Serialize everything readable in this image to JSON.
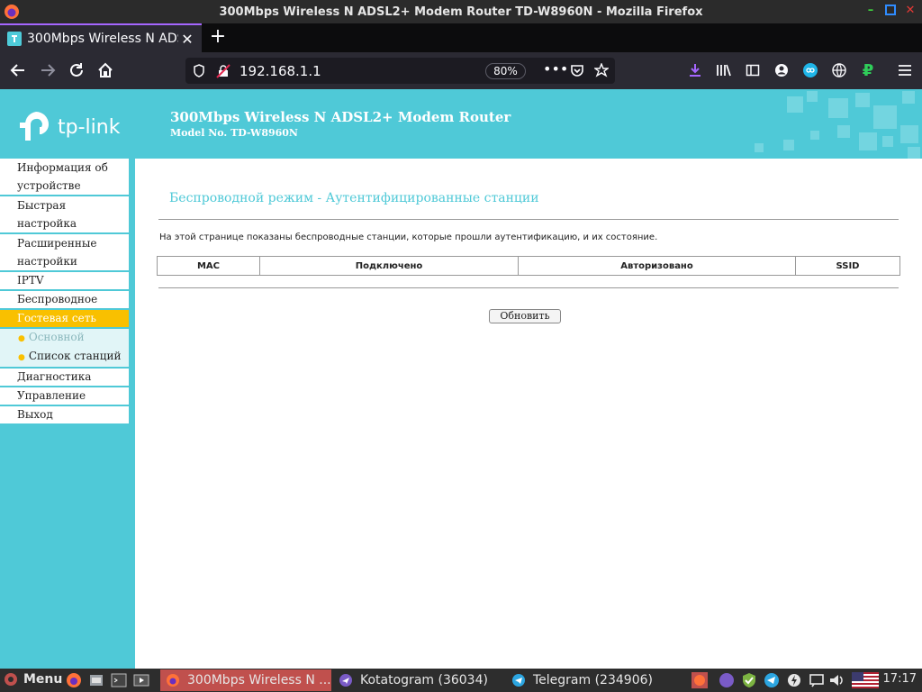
{
  "window": {
    "title": "300Mbps Wireless N ADSL2+ Modem Router TD-W8960N - Mozilla Firefox"
  },
  "browser": {
    "tabs": [
      {
        "label": "300Mbps Wireless N ADS",
        "active": true
      }
    ],
    "url": "192.168.1.1",
    "zoom": "80%"
  },
  "page": {
    "logo_text": "tp-link",
    "header_title": "300Mbps Wireless N ADSL2+ Modem Router",
    "header_model": "Model No. TD-W8960N",
    "menu": {
      "info": "Информация об устройстве",
      "quick": "Быстрая настройка",
      "advanced": "Расширенные настройки",
      "iptv": "IPTV",
      "wireless": "Беспроводное",
      "guest": "Гостевая сеть",
      "sub_basic": "Основной",
      "sub_stations": "Список станций",
      "diag": "Диагностика",
      "manage": "Управление",
      "logout": "Выход"
    },
    "content": {
      "title": "Беспроводной режим - Аутентифицированные станции",
      "description": "На этой странице показаны беспроводные станции, которые прошли аутентификацию, и их состояние.",
      "table_headers": [
        "MAC",
        "Подключено",
        "Авторизовано",
        "SSID"
      ],
      "refresh_label": "Обновить"
    }
  },
  "taskbar": {
    "menu_label": "Menu",
    "tasks": [
      {
        "label": "300Mbps Wireless N ...",
        "active": true
      },
      {
        "label": "Kotatogram (36034)",
        "active": false
      },
      {
        "label": "Telegram (234906)",
        "active": false
      }
    ],
    "clock": "17:17"
  },
  "colors": {
    "tplink_teal": "#4fc9d7",
    "active_menu": "#f9c000",
    "tab_accent": "#a566ff"
  }
}
